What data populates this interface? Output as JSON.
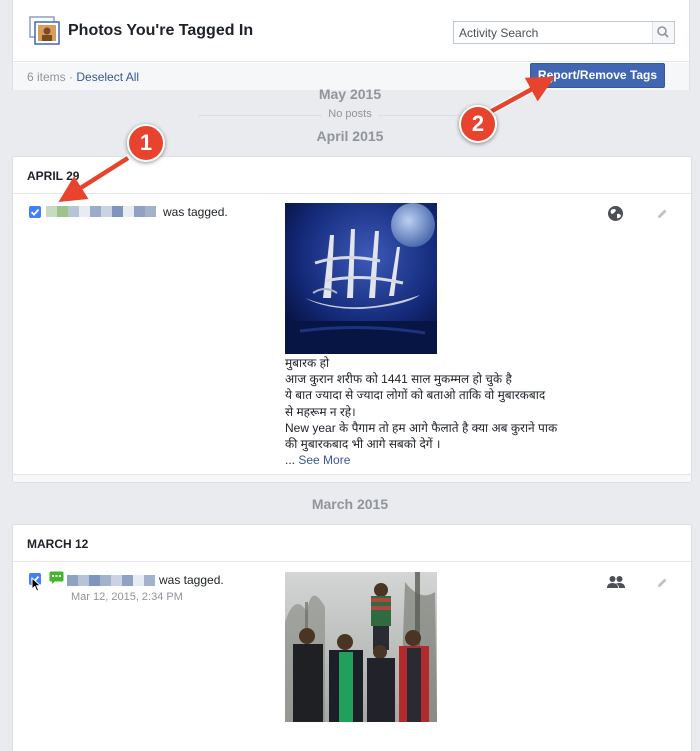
{
  "header": {
    "title": "Photos You're Tagged In",
    "search_placeholder": "Activity Search",
    "items_count": "6 items",
    "separator": "·",
    "deselect_all": "Deselect All",
    "report_button": "Report/Remove Tags"
  },
  "timeline": {
    "month_may": "May 2015",
    "no_posts": "No posts",
    "month_april": "April 2015",
    "month_march": "March 2015"
  },
  "posts": [
    {
      "date": "APRIL 29",
      "tagged_text": "was tagged.",
      "privacy_icon": "globe-icon",
      "lines": [
        "मुबारक हो",
        "आज कुरान शरीफ को 1441 साल मुकम्मल हो चुके है",
        "ये बात ज्यादा से ज्यादा लोगों को बताओ ताकि वो मुबारकबाद",
        "से महरूम न रहे।",
        "New year के पैगाम तो हम आगे फैलाते है क्या अब कुराने पाक",
        "की मुबारकबाद भी आगे सबको देगें ।"
      ],
      "ellipsis": "... ",
      "see_more": "See More"
    },
    {
      "date": "MARCH 12",
      "tagged_text": "was tagged.",
      "timestamp": "Mar 12, 2015, 2:34 PM",
      "privacy_icon": "friends-icon"
    }
  ],
  "annotations": {
    "badge_1": "1",
    "badge_2": "2"
  },
  "colors": {
    "accent": "#4267b2",
    "link": "#365899",
    "annotation": "#e8432c",
    "background": "#e9ebee"
  }
}
